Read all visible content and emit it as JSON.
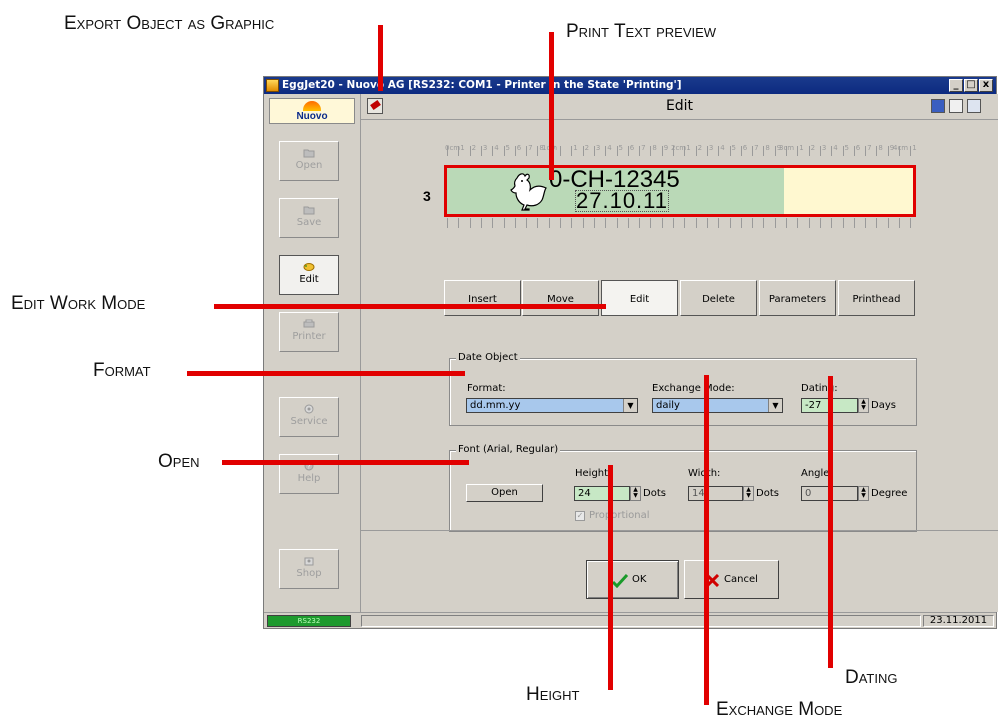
{
  "callouts": {
    "export": "Export Object as Graphic",
    "preview": "Print Text preview",
    "edit_mode": "Edit Work Mode",
    "format": "Format",
    "open": "Open",
    "height": "Height",
    "exchange": "Exchange Mode",
    "dating": "Dating"
  },
  "window": {
    "title": "EggJet20 - Nuovo AG   [RS232: COM1 - Printer in the State 'Printing']",
    "controls": [
      "_",
      "□",
      "x"
    ]
  },
  "header": {
    "title": "Edit"
  },
  "logo": {
    "text": "Nuovo"
  },
  "sidebar": {
    "items": [
      {
        "label": "Open",
        "icon": "folder-icon"
      },
      {
        "label": "Save",
        "icon": "folder-icon"
      },
      {
        "label": "Edit",
        "icon": "edit-icon"
      },
      {
        "label": "Printer",
        "icon": "printer-icon"
      },
      {
        "label": "Service",
        "icon": "service-icon"
      },
      {
        "label": "Help",
        "icon": "help-icon"
      },
      {
        "label": "Shop",
        "icon": "shop-icon"
      }
    ]
  },
  "ruler": {
    "cm_labels": [
      "0cm",
      "1cm",
      "2cm",
      "3cm",
      "4cm"
    ],
    "mm_labels": [
      "1",
      "2",
      "3",
      "4",
      "5",
      "6",
      "7",
      "8",
      "9"
    ]
  },
  "preview": {
    "line_number": "3",
    "line1": "0-CH-12345",
    "line2": "27.10.11"
  },
  "modes": [
    "Insert",
    "Move",
    "Edit",
    "Delete",
    "Parameters",
    "Printhead"
  ],
  "date_object": {
    "title": "Date Object",
    "format_label": "Format:",
    "format_value": "dd.mm.yy",
    "exchange_label": "Exchange Mode:",
    "exchange_value": "daily",
    "dating_label": "Dating:",
    "dating_value": "-27",
    "dating_unit": "Days"
  },
  "font": {
    "title": "Font (Arial, Regular)",
    "open_label": "Open",
    "height_label": "Height:",
    "height_value": "24",
    "width_label": "Width:",
    "width_value": "14",
    "angle_label": "Angle:",
    "angle_value": "0",
    "dots_unit": "Dots",
    "degree_unit": "Degree",
    "proportional_label": "Proportional"
  },
  "buttons": {
    "ok": "OK",
    "cancel": "Cancel"
  },
  "status": {
    "port": "RS232",
    "date": "23.11.2011"
  },
  "colors": {
    "callout_line": "#e10000",
    "preview_bg_green": "#bad9b7",
    "preview_bg_yellow": "#fff8d0",
    "combo_bg": "#a8c8ec",
    "spin_bg": "#c7e8c5"
  }
}
